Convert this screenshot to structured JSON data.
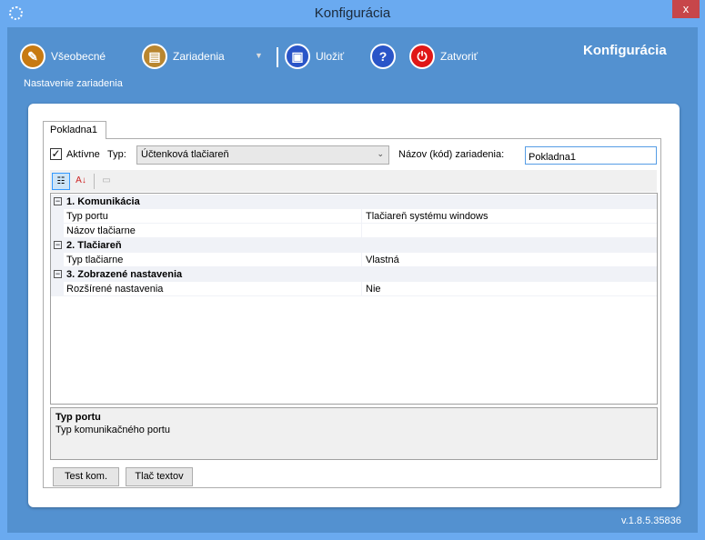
{
  "window": {
    "title": "Konfigurácia",
    "close": "x"
  },
  "toolbar": {
    "items": [
      {
        "label": "Všeobecné",
        "icon": "wrench-icon",
        "color": "#c77a12"
      },
      {
        "label": "Zariadenia",
        "icon": "printer-icon",
        "color": "#b9862f"
      },
      {
        "label": "Uložiť",
        "icon": "save-icon",
        "color": "#2a55c8"
      },
      {
        "label": "?",
        "icon": "help-icon",
        "color": "#2a55c8"
      },
      {
        "label": "Zatvoriť",
        "icon": "power-icon",
        "color": "#e01717"
      }
    ],
    "brand": "Konfigurácia",
    "subtitle": "Nastavenie zariadenia"
  },
  "tab": {
    "label": "Pokladna1"
  },
  "form": {
    "active_label": "Aktívne",
    "active_checked": true,
    "type_label": "Typ:",
    "type_value": "Účtenková tlačiareň",
    "name_label": "Názov (kód) zariadenia:",
    "name_value": "Pokladna1"
  },
  "grid": {
    "categories": [
      {
        "label": "1. Komunikácia",
        "props": [
          {
            "name": "Typ portu",
            "value": "Tlačiareň systému windows"
          },
          {
            "name": "Názov tlačiarne",
            "value": ""
          }
        ]
      },
      {
        "label": "2. Tlačiareň",
        "props": [
          {
            "name": "Typ tlačiarne",
            "value": "Vlastná"
          }
        ]
      },
      {
        "label": "3. Zobrazené nastavenia",
        "props": [
          {
            "name": "Rozšírené nastavenia",
            "value": "Nie"
          }
        ]
      }
    ]
  },
  "description": {
    "title": "Typ portu",
    "text": "Typ komunikačného portu"
  },
  "buttons": {
    "test": "Test kom.",
    "print": "Tlač textov"
  },
  "version": "v.1.8.5.35836"
}
